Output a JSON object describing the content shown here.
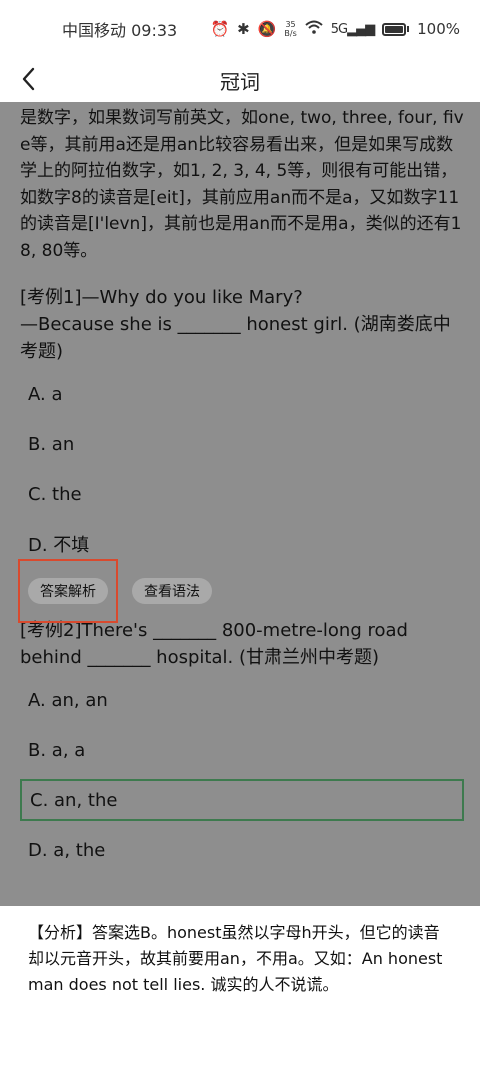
{
  "status": {
    "carrier_time": "中国移动 09:33",
    "net_speed_value": "35",
    "net_speed_unit": "B/s",
    "signal": "5G",
    "battery": "100%"
  },
  "appbar": {
    "title": "冠词"
  },
  "content": {
    "paragraph": "是数字，如果数词写前英文，如one, two, three, four, five等，其前用a还是用an比较容易看出来，但是如果写成数学上的阿拉伯数字，如1, 2, 3, 4, 5等，则很有可能出错，如数字8的读音是[eit]，其前应用an而不是a，又如数字11的读音是[I'levn]，其前也是用an而不是用a，类似的还有18, 80等。",
    "q1": {
      "text": "[考例1]—Why do you like Mary?\n—Because she is _______ honest girl. (湖南娄底中考题)",
      "line1": "[考例1]—Why do you like Mary?",
      "line2": "—Because she is _______ honest girl. (湖南娄底中考题)",
      "options": [
        "A. a",
        "B. an",
        "C. the",
        "D. 不填"
      ]
    },
    "buttons": {
      "analysis": "答案解析",
      "grammar": "查看语法"
    },
    "q2": {
      "line1": "[考例2]There's _______ 800-metre-long road behind _______ hospital. (甘肃兰州中考题)",
      "options": [
        "A. an, an",
        "B. a, a",
        "C. an, the",
        "D. a, the"
      ],
      "selected_index": 2
    }
  },
  "analysis": {
    "text": "【分析】答案选B。honest虽然以字母h开头，但它的读音却以元音开头，故其前要用an，不用a。又如：An honest man does not tell lies. 诚实的人不说谎。"
  }
}
